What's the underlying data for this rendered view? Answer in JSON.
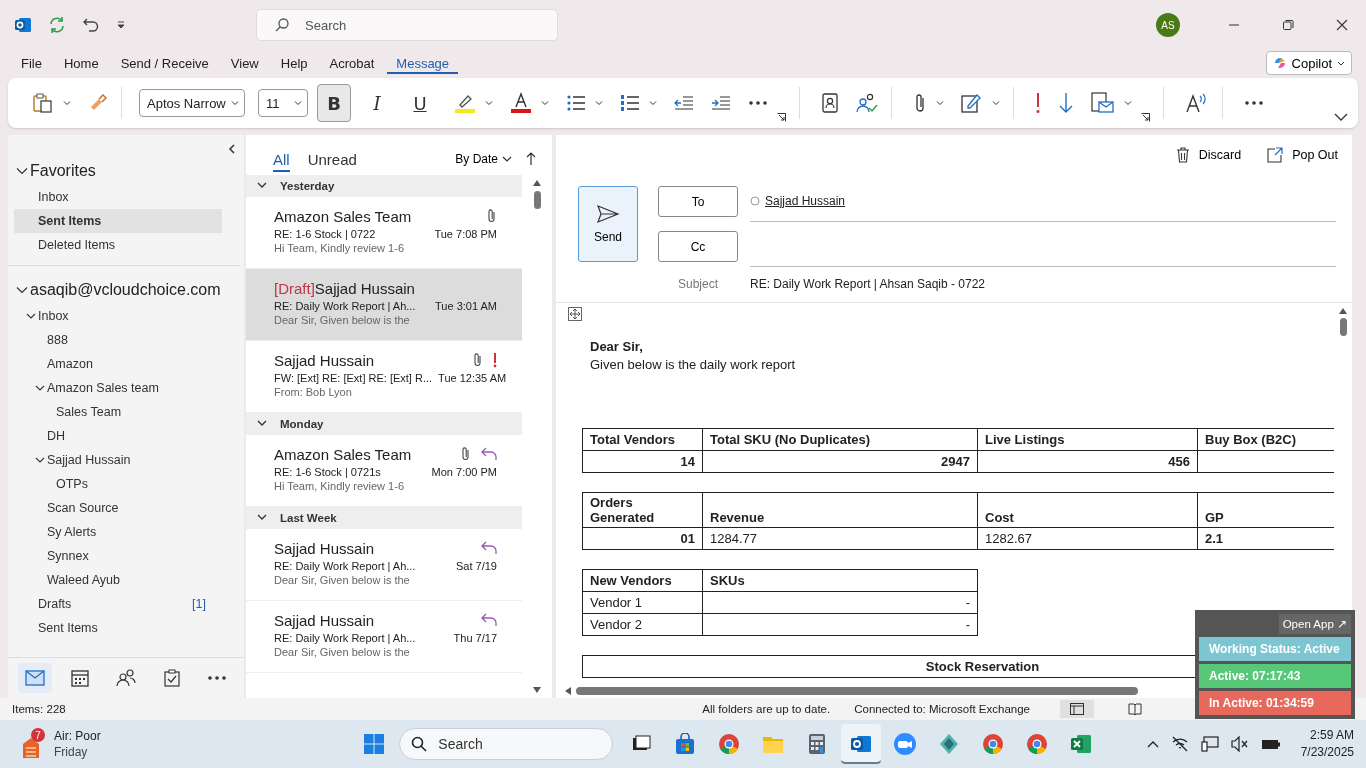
{
  "title_bar": {
    "search_placeholder": "Search",
    "avatar": "AS"
  },
  "menu_tabs": [
    {
      "label": "File",
      "selected": false
    },
    {
      "label": "Home",
      "selected": false
    },
    {
      "label": "Send / Receive",
      "selected": false
    },
    {
      "label": "View",
      "selected": false
    },
    {
      "label": "Help",
      "selected": false
    },
    {
      "label": "Acrobat",
      "selected": false
    },
    {
      "label": "Message",
      "selected": true
    }
  ],
  "copilot": "Copilot",
  "ribbon": {
    "font": "Aptos Narrow",
    "size": "11",
    "format": [
      {
        "label": "B",
        "kind": "bold",
        "on": true
      },
      {
        "label": "I",
        "kind": "italic",
        "on": false
      },
      {
        "label": "U",
        "kind": "underline",
        "on": false
      }
    ]
  },
  "folders": {
    "sections": [
      {
        "label": "Favorites",
        "expanded": true,
        "items": [
          {
            "label": "Inbox",
            "selected": false
          },
          {
            "label": "Sent Items",
            "selected": true
          },
          {
            "label": "Deleted Items",
            "selected": false
          }
        ]
      },
      {
        "label": "asaqib@vcloudchoice.com",
        "expanded": true,
        "items": [
          {
            "label": "Inbox",
            "selected": false,
            "expanded": true,
            "children": [
              {
                "label": "888",
                "selected": false
              },
              {
                "label": "Amazon",
                "selected": false
              },
              {
                "label": "Amazon Sales team",
                "selected": false,
                "expanded": true,
                "children": [
                  {
                    "label": "Sales Team",
                    "selected": false
                  }
                ]
              },
              {
                "label": "DH",
                "selected": false
              },
              {
                "label": "Sajjad Hussain",
                "selected": false,
                "expanded": true,
                "children": [
                  {
                    "label": "OTPs",
                    "selected": false
                  }
                ]
              },
              {
                "label": "Scan Source",
                "selected": false
              },
              {
                "label": "Sy Alerts",
                "selected": false
              },
              {
                "label": "Synnex",
                "selected": false
              },
              {
                "label": "Waleed Ayub",
                "selected": false
              }
            ]
          },
          {
            "label": "Drafts",
            "selected": false,
            "count": "[1]"
          },
          {
            "label": "Sent Items",
            "selected": false
          }
        ]
      }
    ]
  },
  "nav": [
    {
      "kind": "mail",
      "selected": true
    },
    {
      "kind": "calendar",
      "selected": false
    },
    {
      "kind": "people",
      "selected": false
    },
    {
      "kind": "tasks",
      "selected": false
    },
    {
      "kind": "more",
      "selected": false
    }
  ],
  "message_list": {
    "filters": [
      {
        "label": "All",
        "selected": true
      },
      {
        "label": "Unread",
        "selected": false
      }
    ],
    "sort": "By Date",
    "groups": [
      {
        "label": "Yesterday",
        "expanded": true,
        "messages": [
          {
            "sender": "Amazon Sales Team",
            "subject": "RE: 1-6 Stock | 0722",
            "preview": "Hi Team,  Kindly review 1-6",
            "time": "Tue 7:08 PM",
            "attachment": true,
            "important": false,
            "replied": false,
            "selected": false
          },
          {
            "draft_tag": "[Draft]",
            "sender": "Sajjad Hussain",
            "subject": "RE: Daily Work Report | Ah...",
            "preview": "Dear Sir,  Given below is the",
            "time": "Tue 3:01 AM",
            "attachment": false,
            "important": false,
            "replied": false,
            "selected": true
          },
          {
            "sender": "Sajjad Hussain",
            "subject": "FW: [Ext] RE: [Ext] RE: [Ext] R...",
            "preview": "From: Bob Lyon",
            "time": "Tue 12:35 AM",
            "attachment": true,
            "important": true,
            "replied": false,
            "selected": false
          }
        ]
      },
      {
        "label": "Monday",
        "expanded": true,
        "messages": [
          {
            "sender": "Amazon Sales Team",
            "subject": "RE: 1-6 Stock | 0721s",
            "preview": "Hi Team,  Kindly review 1-6",
            "time": "Mon 7:00 PM",
            "attachment": true,
            "important": false,
            "replied": true,
            "selected": false
          }
        ]
      },
      {
        "label": "Last Week",
        "expanded": true,
        "messages": [
          {
            "sender": "Sajjad Hussain",
            "subject": "RE: Daily Work Report | Ah...",
            "preview": "Dear Sir,  Given below is the",
            "time": "Sat 7/19",
            "attachment": false,
            "important": false,
            "replied": true,
            "selected": false
          },
          {
            "sender": "Sajjad Hussain",
            "subject": "RE: Daily Work Report | Ah...",
            "preview": "Dear Sir,  Given below is the",
            "time": "Thu 7/17",
            "attachment": false,
            "important": false,
            "replied": true,
            "selected": false
          }
        ]
      }
    ]
  },
  "compose": {
    "discard": "Discard",
    "pop_out": "Pop Out",
    "send": "Send",
    "to": "To",
    "cc": "Cc",
    "recipient": "Sajjad Hussain",
    "subject_label": "Subject",
    "subject": "RE: Daily Work Report | Ahsan Saqib - 0722",
    "greeting": "Dear Sir,",
    "intro": "Given below is the daily work report",
    "tables": [
      {
        "columns": [
          "Total Vendors",
          "Total SKU (No Duplicates)",
          "Live Listings",
          "Buy Box (B2C)"
        ],
        "rows": [
          [
            "14",
            "2947",
            "456",
            ""
          ]
        ]
      },
      {
        "columns": [
          "Orders Generated",
          "Revenue",
          "Cost",
          "GP"
        ],
        "rows": [
          [
            "01",
            "1284.77",
            "1282.67",
            "2.1"
          ]
        ]
      },
      {
        "columns": [
          "New Vendors",
          "SKUs"
        ],
        "rows": [
          [
            "Vendor 1",
            "-"
          ],
          [
            "Vendor 2",
            "-"
          ]
        ]
      },
      {
        "columns": [
          "Stock Reservation"
        ]
      }
    ]
  },
  "status_widget": {
    "open_app": "Open App ↗",
    "rows": [
      {
        "label": "Working Status: Active",
        "color": "#7cc6d2"
      },
      {
        "label": "Active: 07:17:43",
        "color": "#56c878"
      },
      {
        "label": "In Active: 01:34:59",
        "color": "#e8685c"
      }
    ]
  },
  "status_bar": {
    "items": "Items: 228",
    "sync": "All folders are up to date.",
    "connection": "Connected to: Microsoft Exchange"
  },
  "taskbar": {
    "weather_badge": "7",
    "weather": "Air: Poor",
    "day": "Friday",
    "search_placeholder": "Search",
    "apps": [
      {
        "kind": "taskview",
        "active": false
      },
      {
        "kind": "store",
        "active": false
      },
      {
        "kind": "chrome",
        "active": false
      },
      {
        "kind": "explorer",
        "active": false
      },
      {
        "kind": "calculator",
        "active": false
      },
      {
        "kind": "outlook",
        "active": true
      },
      {
        "kind": "zoom",
        "active": false
      },
      {
        "kind": "kite",
        "active": false
      },
      {
        "kind": "chrome",
        "active": false
      },
      {
        "kind": "chrome",
        "active": false
      },
      {
        "kind": "excel",
        "active": false
      }
    ],
    "time": "2:59 AM",
    "date": "7/23/2025"
  }
}
